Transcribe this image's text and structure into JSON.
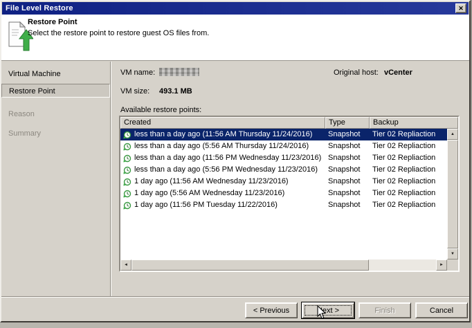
{
  "window": {
    "title": "File Level Restore"
  },
  "icons": {
    "close": "✕",
    "scroll_up": "▲",
    "scroll_down": "▼",
    "scroll_left": "◄",
    "scroll_right": "►"
  },
  "header": {
    "title": "Restore Point",
    "description": "Select the restore point to restore guest OS files from."
  },
  "sidebar": {
    "items": [
      {
        "label": "Virtual Machine",
        "state": "normal"
      },
      {
        "label": "Restore Point",
        "state": "active"
      },
      {
        "label": "Reason",
        "state": "disabled"
      },
      {
        "label": "Summary",
        "state": "disabled"
      }
    ]
  },
  "fields": {
    "vm_name_label": "VM name:",
    "original_host_label": "Original host:",
    "original_host_value": "vCenter",
    "vm_size_label": "VM size:",
    "vm_size_value": "493.1 MB"
  },
  "restore_points": {
    "caption": "Available restore points:",
    "columns": [
      "Created",
      "Type",
      "Backup"
    ],
    "rows": [
      {
        "created": "less than a day ago (11:56 AM Thursday 11/24/2016)",
        "type": "Snapshot",
        "backup": "Tier 02 Repliaction",
        "selected": true
      },
      {
        "created": "less than a day ago (5:56 AM Thursday 11/24/2016)",
        "type": "Snapshot",
        "backup": "Tier 02 Repliaction",
        "selected": false
      },
      {
        "created": "less than a day ago (11:56 PM Wednesday 11/23/2016)",
        "type": "Snapshot",
        "backup": "Tier 02 Repliaction",
        "selected": false
      },
      {
        "created": "less than a day ago (5:56 PM Wednesday 11/23/2016)",
        "type": "Snapshot",
        "backup": "Tier 02 Repliaction",
        "selected": false
      },
      {
        "created": "1 day ago (11:56 AM Wednesday 11/23/2016)",
        "type": "Snapshot",
        "backup": "Tier 02 Repliaction",
        "selected": false
      },
      {
        "created": "1 day ago (5:56 AM Wednesday 11/23/2016)",
        "type": "Snapshot",
        "backup": "Tier 02 Repliaction",
        "selected": false
      },
      {
        "created": "1 day ago (11:56 PM Tuesday 11/22/2016)",
        "type": "Snapshot",
        "backup": "Tier 02 Repliaction",
        "selected": false
      }
    ]
  },
  "buttons": {
    "previous": "< Previous",
    "next": "Next >",
    "finish": "Finish",
    "cancel": "Cancel"
  },
  "colors": {
    "title_bar": "#0f2183",
    "selection": "#0a246a",
    "accent_green": "#3fae49",
    "dialog_face": "#d6d2ca"
  }
}
